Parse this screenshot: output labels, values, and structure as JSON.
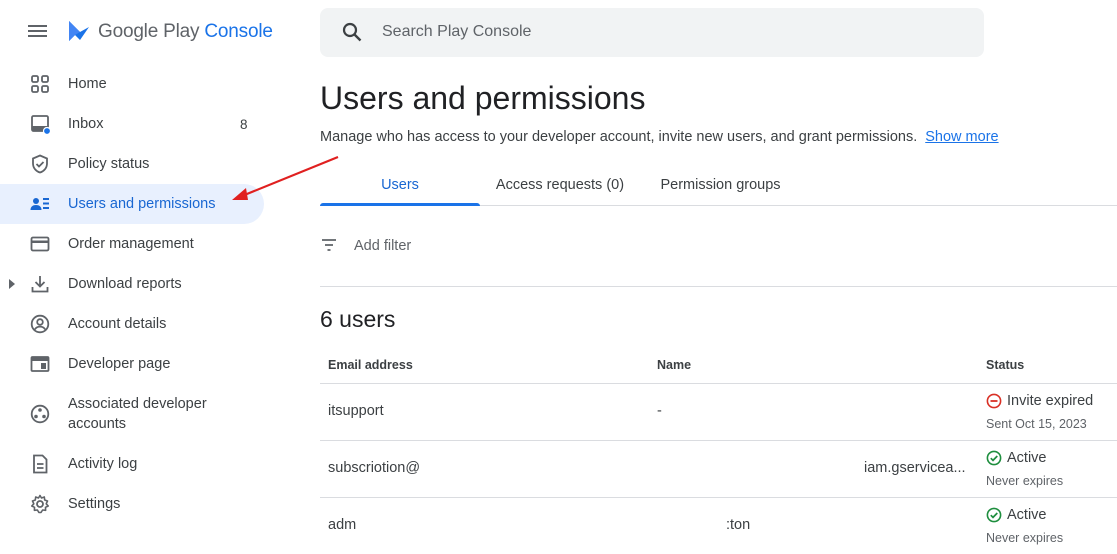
{
  "app": {
    "brand_google": "Google Play",
    "brand_console": "Console"
  },
  "sidebar": {
    "items": [
      {
        "label": "Home",
        "icon": "home-grid-icon"
      },
      {
        "label": "Inbox",
        "icon": "inbox-icon",
        "count": "8"
      },
      {
        "label": "Policy status",
        "icon": "shield-check-icon"
      },
      {
        "label": "Users and permissions",
        "icon": "users-permissions-icon",
        "active": true
      },
      {
        "label": "Order management",
        "icon": "credit-card-icon"
      },
      {
        "label": "Download reports",
        "icon": "download-icon"
      },
      {
        "label": "Account details",
        "icon": "account-circle-icon"
      },
      {
        "label": "Developer page",
        "icon": "developer-page-icon"
      },
      {
        "label": "Associated developer accounts",
        "icon": "associated-accounts-icon"
      },
      {
        "label": "Activity log",
        "icon": "activity-log-icon"
      },
      {
        "label": "Settings",
        "icon": "gear-icon"
      }
    ]
  },
  "search": {
    "placeholder": "Search Play Console"
  },
  "page": {
    "title": "Users and permissions",
    "subtitle": "Manage who has access to your developer account, invite new users, and grant permissions.",
    "show_more": "Show more"
  },
  "tabs": [
    {
      "label": "Users",
      "active": true
    },
    {
      "label": "Access requests (0)"
    },
    {
      "label": "Permission groups"
    }
  ],
  "filter": {
    "label": "Add filter"
  },
  "users": {
    "count_title": "6 users",
    "headers": {
      "email": "Email address",
      "name": "Name",
      "status": "Status"
    },
    "rows": [
      {
        "email": "itsupport",
        "name": "-",
        "extra": "",
        "status": "Invite expired",
        "status_sub": "Sent Oct 15, 2023",
        "status_type": "expired"
      },
      {
        "email": "subscriotion@",
        "name": "",
        "extra": "iam.gservicea...",
        "status": "Active",
        "status_sub": "Never expires",
        "status_type": "active"
      },
      {
        "email": "adm",
        "name": "",
        "extra": ":ton",
        "status": "Active",
        "status_sub": "Never expires",
        "status_type": "active"
      }
    ]
  },
  "colors": {
    "accent": "#1a73e8",
    "active_status": "#1e8e3e",
    "expired_status": "#d93025",
    "annotation_arrow": "#e02020"
  }
}
